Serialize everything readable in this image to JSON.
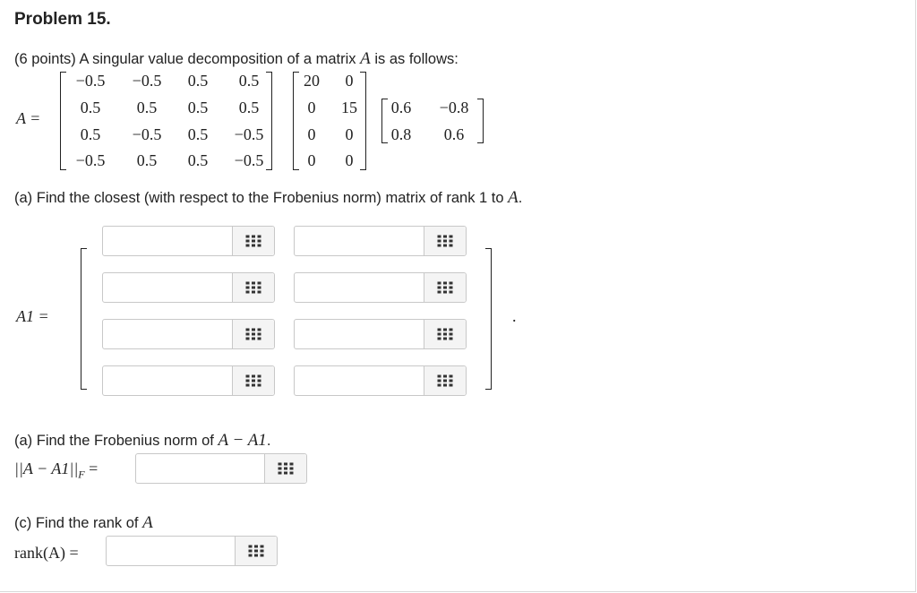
{
  "problem": {
    "title": "Problem 15.",
    "intro_text": "(6 points) A singular value decomposition of a matrix",
    "intro_var": "A",
    "intro_tail": "is as follows:",
    "A_label": "A =",
    "U": [
      [
        "−0.5",
        "−0.5",
        "0.5",
        "0.5"
      ],
      [
        "0.5",
        "0.5",
        "0.5",
        "0.5"
      ],
      [
        "0.5",
        "−0.5",
        "0.5",
        "−0.5"
      ],
      [
        "−0.5",
        "0.5",
        "0.5",
        "−0.5"
      ]
    ],
    "Sigma": [
      [
        "20",
        "0"
      ],
      [
        "0",
        "15"
      ],
      [
        "0",
        "0"
      ],
      [
        "0",
        "0"
      ]
    ],
    "V": [
      [
        "0.6",
        "−0.8"
      ],
      [
        "0.8",
        "0.6"
      ]
    ]
  },
  "part_a": {
    "text": "(a) Find the closest (with respect to the Frobenius norm) matrix of rank 1 to",
    "var": "A",
    "tail": ".",
    "label": "A1 =",
    "trailing_period": ".",
    "inputs": [
      [
        "",
        ""
      ],
      [
        "",
        ""
      ],
      [
        "",
        ""
      ],
      [
        "",
        ""
      ]
    ]
  },
  "part_b": {
    "text": "(a) Find the Frobenius norm of",
    "expr": "A − A1",
    "tail": ".",
    "label_left": "||A − A1||",
    "label_sub": "F",
    "label_eq": "=",
    "value": ""
  },
  "part_c": {
    "text": "(c) Find the rank of",
    "var": "A",
    "label": "rank(A) =",
    "value": ""
  },
  "icons": {
    "matrix_button": "grid-icon"
  }
}
